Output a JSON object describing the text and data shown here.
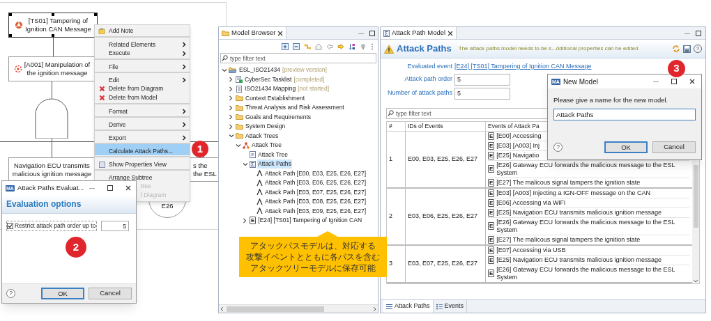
{
  "diagram": {
    "nodes": [
      {
        "kind": "threat",
        "lines": [
          "[TS01] Tampering of",
          "Ignition CAN Message"
        ],
        "selected": true
      },
      {
        "kind": "attack",
        "lines": [
          "[A001] Manipulation of",
          "the ignition message"
        ],
        "selected": false
      },
      {
        "kind": "event",
        "lines": [
          "Navigation ECU transmits",
          "malicious ignition message"
        ],
        "selected": false
      },
      {
        "kind": "event",
        "lines": [
          "s the",
          "the ESL"
        ],
        "selected": false
      },
      {
        "kind": "circle",
        "lines": [
          "E26"
        ],
        "selected": false
      }
    ]
  },
  "context_menu": {
    "items": [
      {
        "label": "Add Note",
        "kind": "note",
        "submenu": false,
        "separator_before": false,
        "selected": false,
        "disabled": false
      },
      {
        "label": "Related Elements",
        "kind": "plain",
        "submenu": true,
        "separator_before": true,
        "selected": false,
        "disabled": false
      },
      {
        "label": "Execute",
        "kind": "plain",
        "submenu": true,
        "separator_before": false,
        "selected": false,
        "disabled": false
      },
      {
        "label": "File",
        "kind": "plain",
        "submenu": true,
        "separator_before": true,
        "selected": false,
        "disabled": false
      },
      {
        "label": "Edit",
        "kind": "plain",
        "submenu": true,
        "separator_before": true,
        "selected": false,
        "disabled": false
      },
      {
        "label": "Delete from Diagram",
        "kind": "delete",
        "submenu": false,
        "separator_before": false,
        "selected": false,
        "disabled": false
      },
      {
        "label": "Delete from Model",
        "kind": "delete",
        "submenu": false,
        "separator_before": false,
        "selected": false,
        "disabled": false
      },
      {
        "label": "Format",
        "kind": "plain",
        "submenu": true,
        "separator_before": true,
        "selected": false,
        "disabled": false
      },
      {
        "label": "Derive",
        "kind": "plain",
        "submenu": true,
        "separator_before": true,
        "selected": false,
        "disabled": false
      },
      {
        "label": "Export",
        "kind": "plain",
        "submenu": true,
        "separator_before": true,
        "selected": false,
        "disabled": false
      },
      {
        "label": "Calculate Attack Paths...",
        "kind": "plain",
        "submenu": false,
        "separator_before": true,
        "selected": true,
        "disabled": false
      },
      {
        "label": "Show Properties View",
        "kind": "toggle",
        "submenu": false,
        "separator_before": true,
        "selected": false,
        "disabled": false
      },
      {
        "label": "Arrange Subtree",
        "kind": "plain",
        "submenu": false,
        "separator_before": true,
        "selected": false,
        "disabled": false
      },
      {
        "label": "tree",
        "kind": "plain",
        "submenu": false,
        "separator_before": false,
        "selected": false,
        "disabled": true
      },
      {
        "label": "l Diagram",
        "kind": "plain",
        "submenu": false,
        "separator_before": false,
        "selected": false,
        "disabled": true
      }
    ]
  },
  "eval_dialog": {
    "logo": "MA",
    "title": "Attack Paths Evaluat...",
    "header": "Evaluation options",
    "option": {
      "label": "Restrict attack path order up to",
      "checked": true,
      "value": "5"
    },
    "help": "?",
    "buttons": [
      {
        "label": "OK",
        "default": true
      },
      {
        "label": "Cancel",
        "default": false
      }
    ]
  },
  "model_browser": {
    "tab": "Model Browser",
    "filter": {
      "placeholder": "type filter text"
    },
    "tree": [
      {
        "kind": "project",
        "label": "ESL_ISO21434",
        "status": "[preview version]",
        "expanded": true,
        "selected": false,
        "children": [
          {
            "kind": "tasklist",
            "label": "CyberSec Tasklist",
            "status": "[completed]",
            "expanded": false,
            "selected": false
          },
          {
            "kind": "mapping",
            "label": "ISO21434 Mapping",
            "status": "[not started]",
            "expanded": false,
            "selected": false
          },
          {
            "kind": "folder",
            "label": "Context Establishment",
            "expanded": false,
            "selected": false
          },
          {
            "kind": "folder",
            "label": "Threat Analysis and Risk Assessment",
            "expanded": false,
            "selected": false
          },
          {
            "kind": "folder",
            "label": "Goals and Requirements",
            "expanded": false,
            "selected": false
          },
          {
            "kind": "folder",
            "label": "System Design",
            "expanded": false,
            "selected": false
          },
          {
            "kind": "folder",
            "label": "Attack Trees",
            "expanded": true,
            "selected": false,
            "children": [
              {
                "kind": "attack-tree",
                "label": "Attack Tree",
                "expanded": true,
                "selected": false,
                "children": [
                  {
                    "kind": "diagram",
                    "label": "Attack Tree",
                    "selected": false
                  },
                  {
                    "kind": "paths",
                    "label": "Attack Paths",
                    "expanded": true,
                    "selected": true,
                    "children": [
                      {
                        "kind": "path",
                        "label": "Attack Path [E00, E03, E25, E26, E27]",
                        "selected": false
                      },
                      {
                        "kind": "path",
                        "label": "Attack Path [E03, E06, E25, E26, E27]",
                        "selected": false
                      },
                      {
                        "kind": "path",
                        "label": "Attack Path [E03, E07, E25, E26, E27]",
                        "selected": false
                      },
                      {
                        "kind": "path",
                        "label": "Attack Path [E03, E08, E25, E26, E27]",
                        "selected": false
                      },
                      {
                        "kind": "path",
                        "label": "Attack Path [E03, E09, E25, E26, E27]",
                        "selected": false
                      }
                    ]
                  },
                  {
                    "kind": "event",
                    "tag": "E",
                    "label": "[E24] [TS01] Tampering of Ignition CAN",
                    "expanded": false,
                    "selected": false
                  }
                ]
              }
            ]
          }
        ]
      }
    ]
  },
  "attack_path_model": {
    "tab": "Attack Path Model",
    "header": {
      "title": "Attack Paths",
      "message": "The attack paths model needs to be s...dditional properties can be edited",
      "help": "?"
    },
    "fields": [
      {
        "label": "Evaluated event",
        "kind": "link",
        "value": "[E24] [TS01] Tampering of Ignition CAN Message"
      },
      {
        "label": "Attack path order",
        "kind": "input",
        "value": "5"
      },
      {
        "label": "Number of attack paths",
        "kind": "input",
        "value": "5"
      }
    ],
    "filter": {
      "placeholder": "type filter text"
    },
    "table": {
      "columns": [
        "#",
        "IDs of Events",
        "Events of Attack Pa"
      ],
      "rows": [
        {
          "number": "1",
          "ids": "E00, E03, E25, E26, E27",
          "events": [
            {
              "tag": "E",
              "text": "[E00] Accessing"
            },
            {
              "tag": "E",
              "text": "[E03] [A003] Inj"
            },
            {
              "tag": "E",
              "text": "[E25] Navigatio"
            },
            {
              "tag": "E",
              "text": "[E26] Gateway ECU forwards the malicious message to the ESL System"
            },
            {
              "tag": "E",
              "text": "[E27] The malicous signal tampers the ignition state"
            }
          ]
        },
        {
          "number": "2",
          "ids": "E03, E06, E25, E26, E27",
          "events": [
            {
              "tag": "E",
              "text": "[E03] [A003] Injecting a IGN-OFF message on the CAN"
            },
            {
              "tag": "E",
              "text": "[E06] Accessing via WiFi"
            },
            {
              "tag": "E",
              "text": "[E25] Navigation ECU transmits malicious ignition message"
            },
            {
              "tag": "E",
              "text": "[E26] Gateway ECU forwards the malicious message to the ESL System"
            },
            {
              "tag": "E",
              "text": "[E27] The malicous signal tampers the ignition state"
            }
          ]
        },
        {
          "number": "3",
          "ids": "E03, E07, E25, E26, E27",
          "events": [
            {
              "tag": "E",
              "text": "[E07] Accessing via USB"
            },
            {
              "tag": "E",
              "text": "[E25] Navigation ECU transmits malicious ignition message"
            },
            {
              "tag": "E",
              "text": "[E26] Gateway ECU forwards the malicious message to the ESL System"
            }
          ]
        }
      ]
    },
    "bottom_tabs": [
      {
        "label": "Attack Paths",
        "selected": true
      },
      {
        "label": "Events",
        "selected": false
      }
    ]
  },
  "new_model_dialog": {
    "logo": "MA",
    "title": "New Model",
    "prompt": "Please give a name for the new model.",
    "value": "Attack Paths",
    "help": "?",
    "buttons": [
      {
        "label": "OK",
        "default": true
      },
      {
        "label": "Cancel",
        "default": false
      }
    ]
  },
  "callout": {
    "lines": [
      "アタックパスモデルは、対応する",
      "攻撃イベントとともに各パスを含む",
      "アタックツリーモデルに保存可能"
    ]
  },
  "step_badges": [
    "1",
    "2",
    "3"
  ]
}
